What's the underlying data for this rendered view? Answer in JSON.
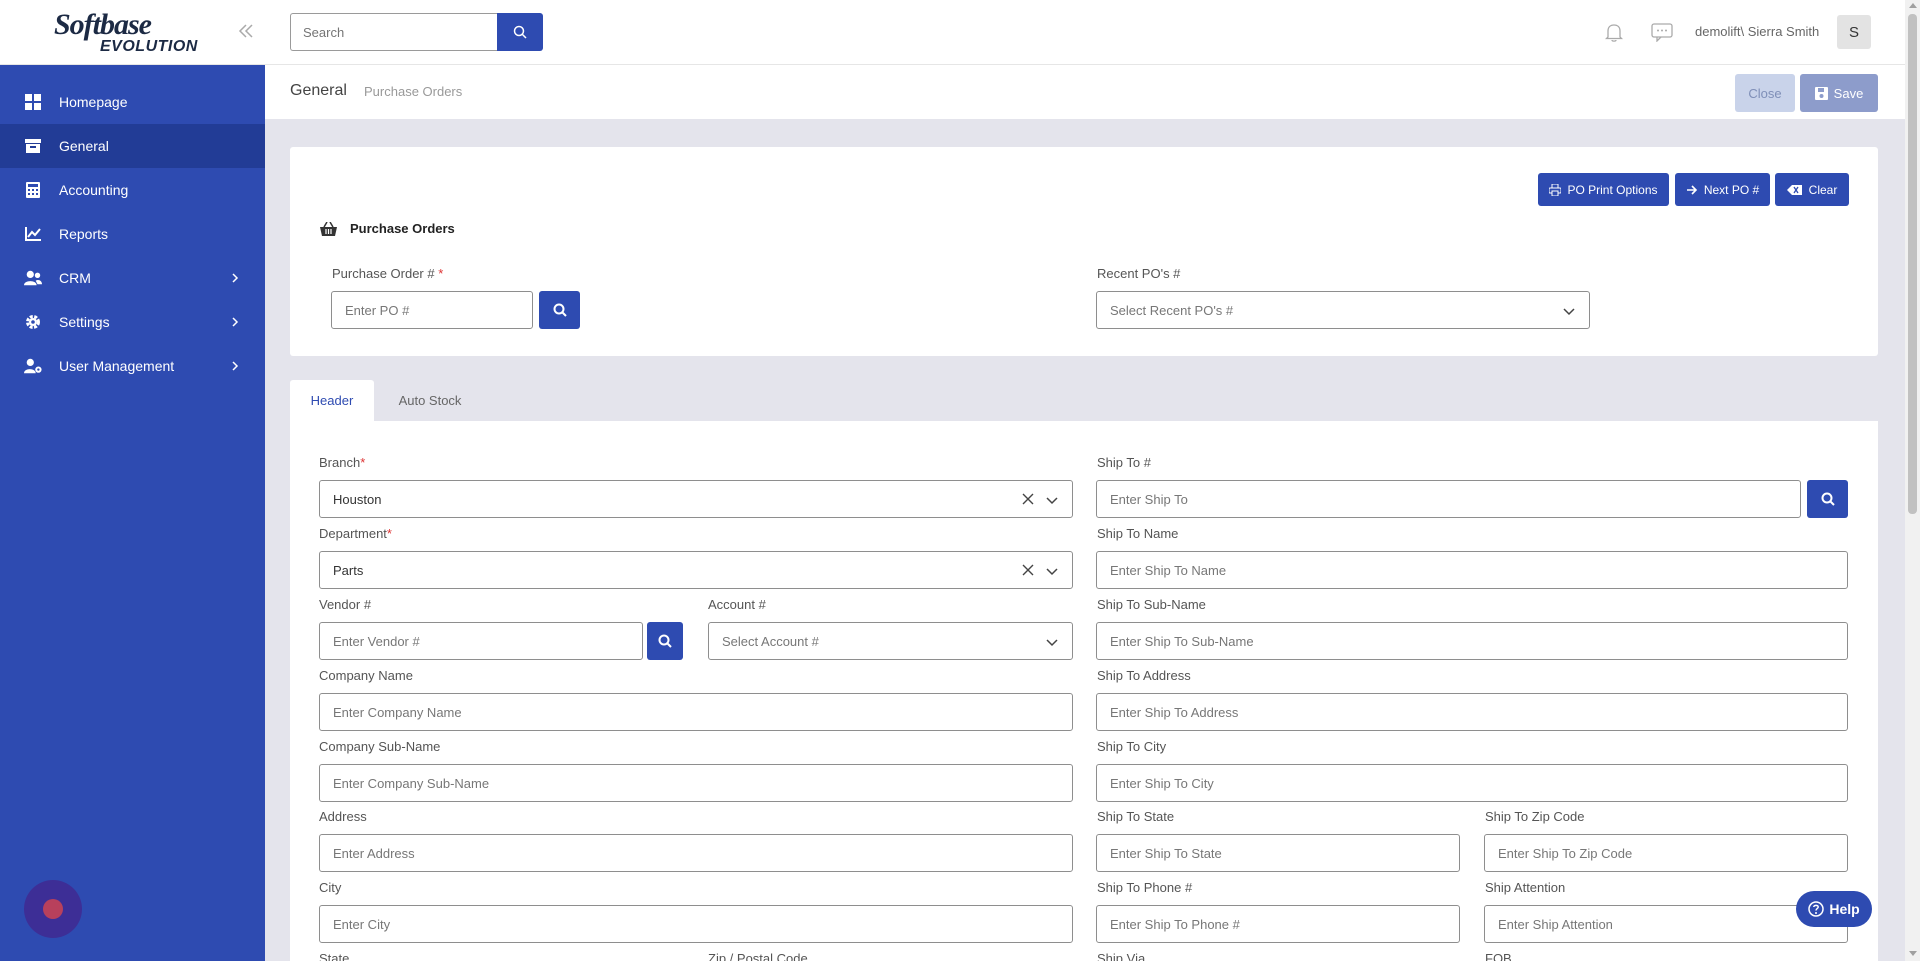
{
  "app": {
    "logo_line1": "Softbase",
    "logo_line2": "EVOLUTION"
  },
  "sidebar": {
    "items": [
      {
        "label": "Homepage",
        "icon": "grid-icon",
        "active": false,
        "has_children": false
      },
      {
        "label": "General",
        "icon": "archive-icon",
        "active": true,
        "has_children": false
      },
      {
        "label": "Accounting",
        "icon": "calculator-icon",
        "active": false,
        "has_children": false
      },
      {
        "label": "Reports",
        "icon": "chart-icon",
        "active": false,
        "has_children": false
      },
      {
        "label": "CRM",
        "icon": "users-icon",
        "active": false,
        "has_children": true
      },
      {
        "label": "Settings",
        "icon": "gear-icon",
        "active": false,
        "has_children": true
      },
      {
        "label": "User Management",
        "icon": "user-cog-icon",
        "active": false,
        "has_children": true
      }
    ]
  },
  "topbar": {
    "search_placeholder": "Search",
    "user": "demolift\\ Sierra Smith",
    "avatar_initial": "S"
  },
  "breadcrumb": {
    "title": "General",
    "subtitle": "Purchase Orders",
    "close_label": "Close",
    "save_label": "Save"
  },
  "po_card": {
    "print_options_label": "PO Print Options",
    "next_po_label": "Next PO #",
    "clear_label": "Clear",
    "section_title": "Purchase Orders",
    "po_number_label": "Purchase Order #",
    "required_mark": "*",
    "po_number_placeholder": "Enter PO #",
    "recent_label": "Recent PO's #",
    "recent_placeholder": "Select Recent PO's #"
  },
  "tabs": [
    {
      "label": "Header",
      "active": true
    },
    {
      "label": "Auto Stock",
      "active": false
    }
  ],
  "header_form": {
    "required_mark": "*",
    "branch_label": "Branch",
    "branch_value": "Houston",
    "department_label": "Department",
    "department_value": "Parts",
    "vendor_label": "Vendor #",
    "vendor_placeholder": "Enter Vendor #",
    "account_label": "Account #",
    "account_placeholder": "Select Account #",
    "company_name_label": "Company Name",
    "company_name_placeholder": "Enter Company Name",
    "company_subname_label": "Company Sub-Name",
    "company_subname_placeholder": "Enter Company Sub-Name",
    "address_label": "Address",
    "address_placeholder": "Enter Address",
    "city_label": "City",
    "city_placeholder": "Enter City",
    "state_label": "State",
    "zip_label": "Zip / Postal Code",
    "ship_to_label": "Ship To #",
    "ship_to_placeholder": "Enter Ship To",
    "ship_to_name_label": "Ship To Name",
    "ship_to_name_placeholder": "Enter Ship To Name",
    "ship_to_subname_label": "Ship To Sub-Name",
    "ship_to_subname_placeholder": "Enter Ship To Sub-Name",
    "ship_to_address_label": "Ship To Address",
    "ship_to_address_placeholder": "Enter Ship To Address",
    "ship_to_city_label": "Ship To City",
    "ship_to_city_placeholder": "Enter Ship To City",
    "ship_to_state_label": "Ship To State",
    "ship_to_state_placeholder": "Enter Ship To State",
    "ship_to_zip_label": "Ship To Zip Code",
    "ship_to_zip_placeholder": "Enter Ship To Zip Code",
    "ship_to_phone_label": "Ship To Phone #",
    "ship_to_phone_placeholder": "Enter Ship To Phone #",
    "ship_attention_label": "Ship Attention",
    "ship_attention_placeholder": "Enter Ship Attention",
    "ship_via_label": "Ship Via",
    "fob_label": "FOB"
  },
  "help": {
    "label": "Help"
  },
  "colors": {
    "primary": "#2e4bb1",
    "sidebar_active": "#223c96",
    "required": "#d33333"
  }
}
